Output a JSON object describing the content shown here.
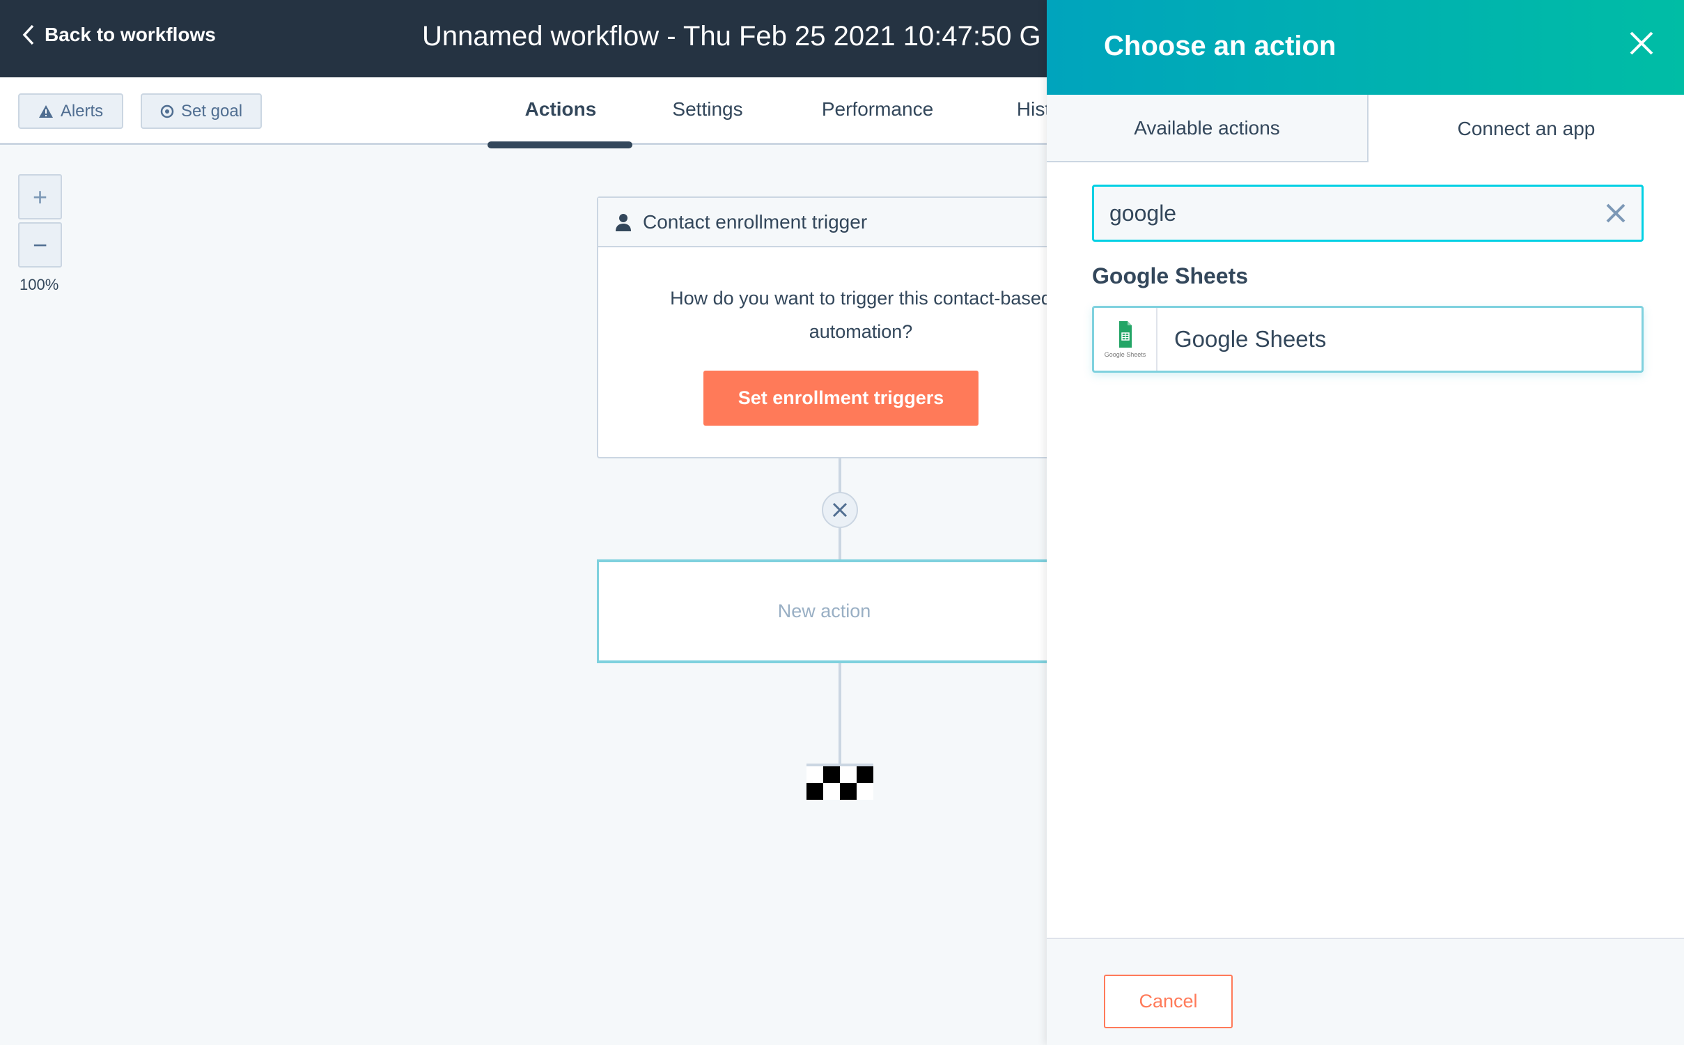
{
  "header": {
    "back_label": "Back to workflows",
    "title": "Unnamed workflow - Thu Feb 25 2021 10:47:50 G"
  },
  "toolbar": {
    "alerts": "Alerts",
    "set_goal": "Set goal",
    "tabs": [
      "Actions",
      "Settings",
      "Performance",
      "Hist"
    ],
    "active_tab": "Actions"
  },
  "canvas": {
    "zoom_in": "+",
    "zoom_out": "−",
    "zoom_level": "100%",
    "trigger": {
      "title": "Contact enrollment trigger",
      "question": "How do you want to trigger this contact-based automation?",
      "button": "Set enrollment triggers"
    },
    "new_action": "New action"
  },
  "panel": {
    "title": "Choose an action",
    "tabs": [
      "Available actions",
      "Connect an app"
    ],
    "active_tab": "Connect an app",
    "search_value": "google",
    "group_heading": "Google Sheets",
    "results": [
      {
        "name": "Google Sheets",
        "logo_caption": "Google Sheets"
      }
    ],
    "cancel": "Cancel"
  },
  "colors": {
    "topbar": "#253342",
    "accent": "#ff7a59",
    "teal": "#00a4bd",
    "sheets_green": "#23a566"
  }
}
